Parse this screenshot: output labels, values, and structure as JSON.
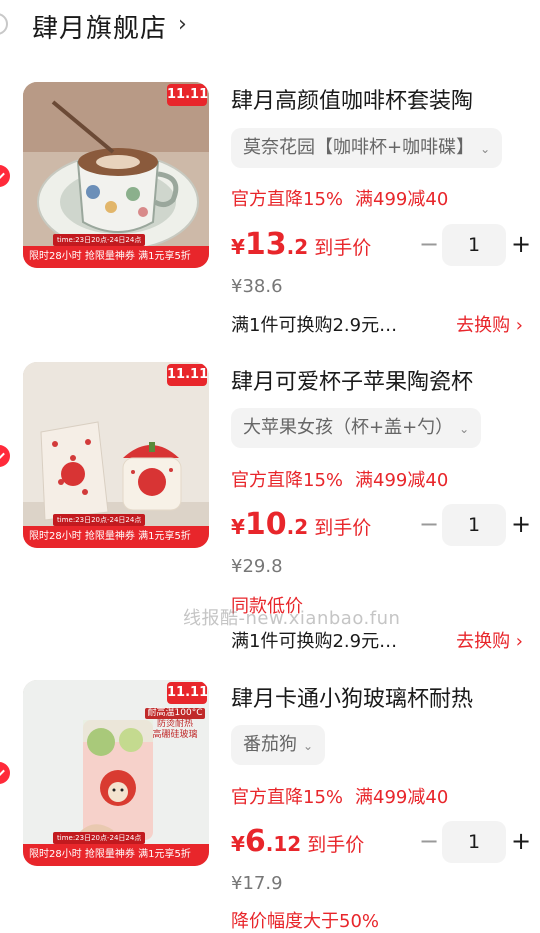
{
  "store": {
    "name": "肆月旗舰店",
    "chevron": "›"
  },
  "watermark": "线报酷-new.xianbao.fun",
  "items": [
    {
      "title": "肆月高颜值咖啡杯套装陶",
      "variant": "莫奈花园【咖啡杯+咖啡碟】",
      "discount_a": "官方直降15%",
      "discount_b": "满499减40",
      "price_currency": "¥",
      "price_int": "13",
      "price_dec": ".2",
      "price_suffix": "到手价",
      "original_price": "¥38.6",
      "qty": "1",
      "minus": "−",
      "plus": "+",
      "swap_text": "满1件可换购2.9元…",
      "swap_link": "去换购 ›",
      "badge": "11.11",
      "promo_date": "time:23日20点-24日24点",
      "promo_strip": "限时28小时 抢限量神券 满1元享5折"
    },
    {
      "title": "肆月可爱杯子苹果陶瓷杯",
      "variant": "大苹果女孩（杯+盖+勺）",
      "discount_a": "官方直降15%",
      "discount_b": "满499减40",
      "price_currency": "¥",
      "price_int": "10",
      "price_dec": ".2",
      "price_suffix": "到手价",
      "original_price": "¥29.8",
      "note": "同款低价",
      "qty": "1",
      "minus": "−",
      "plus": "+",
      "swap_text": "满1件可换购2.9元…",
      "swap_link": "去换购 ›",
      "badge": "11.11",
      "promo_date": "time:23日20点-24日24点",
      "promo_strip": "限时28小时 抢限量神券 满1元享5折"
    },
    {
      "title": "肆月卡通小狗玻璃杯耐热",
      "variant": "番茄狗",
      "discount_a": "官方直降15%",
      "discount_b": "满499减40",
      "price_currency": "¥",
      "price_int": "6",
      "price_dec": ".12",
      "price_suffix": "到手价",
      "original_price": "¥17.9",
      "note": "降价幅度大于50%",
      "qty": "1",
      "minus": "−",
      "plus": "+",
      "badge": "11.11",
      "promo_date": "time:23日20点-24日24点",
      "promo_strip": "限时28小时 抢限量神券 满1元享5折",
      "product_tag_1": "耐高温100°C",
      "product_tag_2": "防烫耐热",
      "product_tag_3": "高硼硅玻璃"
    }
  ]
}
